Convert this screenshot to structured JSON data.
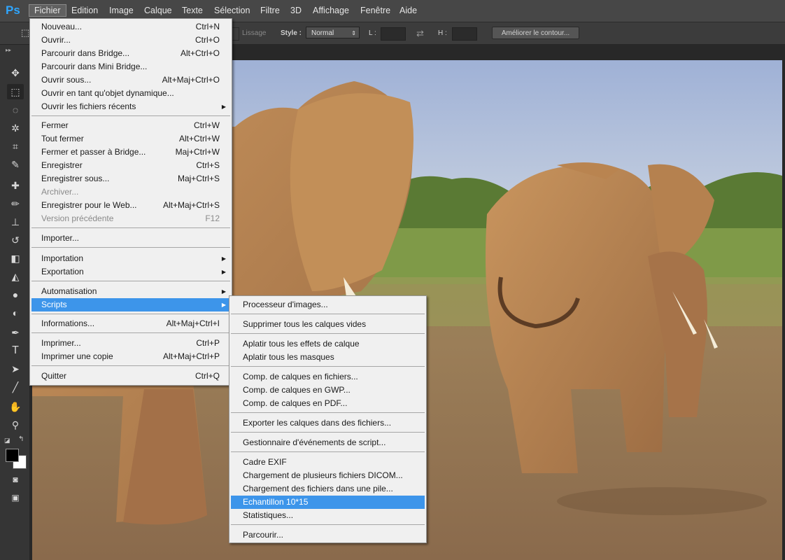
{
  "menubar": {
    "logo": "Ps",
    "items": [
      "Fichier",
      "Edition",
      "Image",
      "Calque",
      "Texte",
      "Sélection",
      "Filtre",
      "3D",
      "Affichage",
      "Fenêtre",
      "Aide"
    ]
  },
  "options_bar": {
    "lissage": "Lissage",
    "style_label": "Style :",
    "style_value": "Normal",
    "l_label": "L :",
    "h_label": "H :",
    "refine_button": "Améliorer le contour..."
  },
  "tools": [
    {
      "name": "move-tool",
      "glyph": "✥"
    },
    {
      "name": "marquee-tool",
      "glyph": "⬚"
    },
    {
      "name": "lasso-tool",
      "glyph": "◌"
    },
    {
      "name": "magic-wand-tool",
      "glyph": "✲"
    },
    {
      "name": "crop-tool",
      "glyph": "⌗"
    },
    {
      "name": "eyedropper-tool",
      "glyph": "✎"
    },
    {
      "name": "healing-brush-tool",
      "glyph": "✚"
    },
    {
      "name": "brush-tool",
      "glyph": "✏"
    },
    {
      "name": "stamp-tool",
      "glyph": "⊥"
    },
    {
      "name": "history-brush-tool",
      "glyph": "↺"
    },
    {
      "name": "eraser-tool",
      "glyph": "◧"
    },
    {
      "name": "paint-bucket-tool",
      "glyph": "◭"
    },
    {
      "name": "blur-tool",
      "glyph": "●"
    },
    {
      "name": "dodge-tool",
      "glyph": "◐"
    },
    {
      "name": "pen-tool",
      "glyph": "✒"
    },
    {
      "name": "type-tool",
      "glyph": "T"
    },
    {
      "name": "path-selection-tool",
      "glyph": "➤"
    },
    {
      "name": "line-tool",
      "glyph": "╱"
    },
    {
      "name": "hand-tool",
      "glyph": "✋"
    },
    {
      "name": "zoom-tool",
      "glyph": "⚲"
    }
  ],
  "colors": {
    "foreground": "#000000",
    "background": "#ffffff",
    "highlight": "#3d95ea",
    "menubar": "#474747",
    "toolbar": "#353535"
  },
  "fichier_menu": {
    "items": [
      {
        "label": "Nouveau...",
        "shortcut": "Ctrl+N"
      },
      {
        "label": "Ouvrir...",
        "shortcut": "Ctrl+O"
      },
      {
        "label": "Parcourir dans Bridge...",
        "shortcut": "Alt+Ctrl+O"
      },
      {
        "label": "Parcourir dans Mini Bridge...",
        "shortcut": ""
      },
      {
        "label": "Ouvrir sous...",
        "shortcut": "Alt+Maj+Ctrl+O"
      },
      {
        "label": "Ouvrir en tant qu'objet dynamique...",
        "shortcut": ""
      },
      {
        "label": "Ouvrir les fichiers récents",
        "shortcut": "",
        "submenu": true
      },
      {
        "label": "Fermer",
        "shortcut": "Ctrl+W"
      },
      {
        "label": "Tout fermer",
        "shortcut": "Alt+Ctrl+W"
      },
      {
        "label": "Fermer et passer à Bridge...",
        "shortcut": "Maj+Ctrl+W"
      },
      {
        "label": "Enregistrer",
        "shortcut": "Ctrl+S"
      },
      {
        "label": "Enregistrer sous...",
        "shortcut": "Maj+Ctrl+S"
      },
      {
        "label": "Archiver...",
        "shortcut": "",
        "disabled": true
      },
      {
        "label": "Enregistrer pour le Web...",
        "shortcut": "Alt+Maj+Ctrl+S"
      },
      {
        "label": "Version précédente",
        "shortcut": "F12",
        "disabled": true
      },
      {
        "label": "Importer...",
        "shortcut": ""
      },
      {
        "label": "Importation",
        "shortcut": "",
        "submenu": true
      },
      {
        "label": "Exportation",
        "shortcut": "",
        "submenu": true
      },
      {
        "label": "Automatisation",
        "shortcut": "",
        "submenu": true
      },
      {
        "label": "Scripts",
        "shortcut": "",
        "submenu": true,
        "highlighted": true
      },
      {
        "label": "Informations...",
        "shortcut": "Alt+Maj+Ctrl+I"
      },
      {
        "label": "Imprimer...",
        "shortcut": "Ctrl+P"
      },
      {
        "label": "Imprimer une copie",
        "shortcut": "Alt+Maj+Ctrl+P"
      },
      {
        "label": "Quitter",
        "shortcut": "Ctrl+Q"
      }
    ]
  },
  "scripts_menu": {
    "items": [
      {
        "label": "Processeur d'images..."
      },
      {
        "label": "Supprimer tous les calques vides"
      },
      {
        "label": "Aplatir tous les effets de calque"
      },
      {
        "label": "Aplatir tous les masques"
      },
      {
        "label": "Comp. de calques en fichiers..."
      },
      {
        "label": "Comp. de calques en GWP..."
      },
      {
        "label": "Comp. de calques en PDF..."
      },
      {
        "label": "Exporter les calques dans des fichiers..."
      },
      {
        "label": "Gestionnaire d'événements de script..."
      },
      {
        "label": "Cadre EXIF"
      },
      {
        "label": "Chargement de plusieurs fichiers DICOM..."
      },
      {
        "label": "Chargement des fichiers dans une pile..."
      },
      {
        "label": "Echantillon 10*15",
        "highlighted": true
      },
      {
        "label": "Statistiques..."
      },
      {
        "label": "Parcourir..."
      }
    ]
  }
}
